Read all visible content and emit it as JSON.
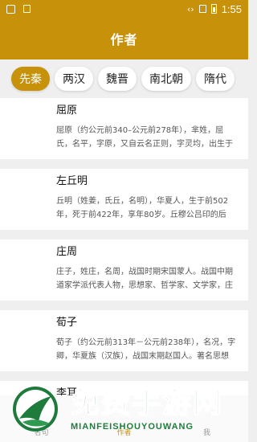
{
  "status_bar": {
    "time": "1:55"
  },
  "app_bar": {
    "title": "作者"
  },
  "tabs": [
    {
      "label": "先秦",
      "active": true
    },
    {
      "label": "两汉",
      "active": false
    },
    {
      "label": "魏晋",
      "active": false
    },
    {
      "label": "南北朝",
      "active": false
    },
    {
      "label": "隋代",
      "active": false
    }
  ],
  "authors": [
    {
      "name": "屈原",
      "desc": "屈原（约公元前340–公元前278年），芈姓，屈氏，名平，字原，又自云名正则，字灵均，出生于楚国丹"
    },
    {
      "name": "左丘明",
      "desc": "丘明（姓姜，氏丘，名明），华夏人，生于前502年，死于前422年，享年80岁。丘穆公吕印的后代。"
    },
    {
      "name": "庄周",
      "desc": "庄子，姓庄，名周，战国时期宋国蒙人。战国中期道家学派代表人物，思想家、哲学家、文学家，庄学的"
    },
    {
      "name": "荀子",
      "desc": "荀子（约公元前313年－公元前238年），名况，字卿，华夏族（汉族），战国末期赵国人。著名思想"
    },
    {
      "name": "李耳",
      "desc": ""
    }
  ],
  "bottom_nav": [
    {
      "label": "名句",
      "active": false
    },
    {
      "label": "作者",
      "active": true
    },
    {
      "label": "我",
      "active": false
    }
  ],
  "watermark": {
    "main": "免费手游网",
    "sub": "MIANFEISHOUYOUWANG"
  },
  "colors": {
    "accent": "#c8910a",
    "watermark_green": "#1e7b3c"
  }
}
